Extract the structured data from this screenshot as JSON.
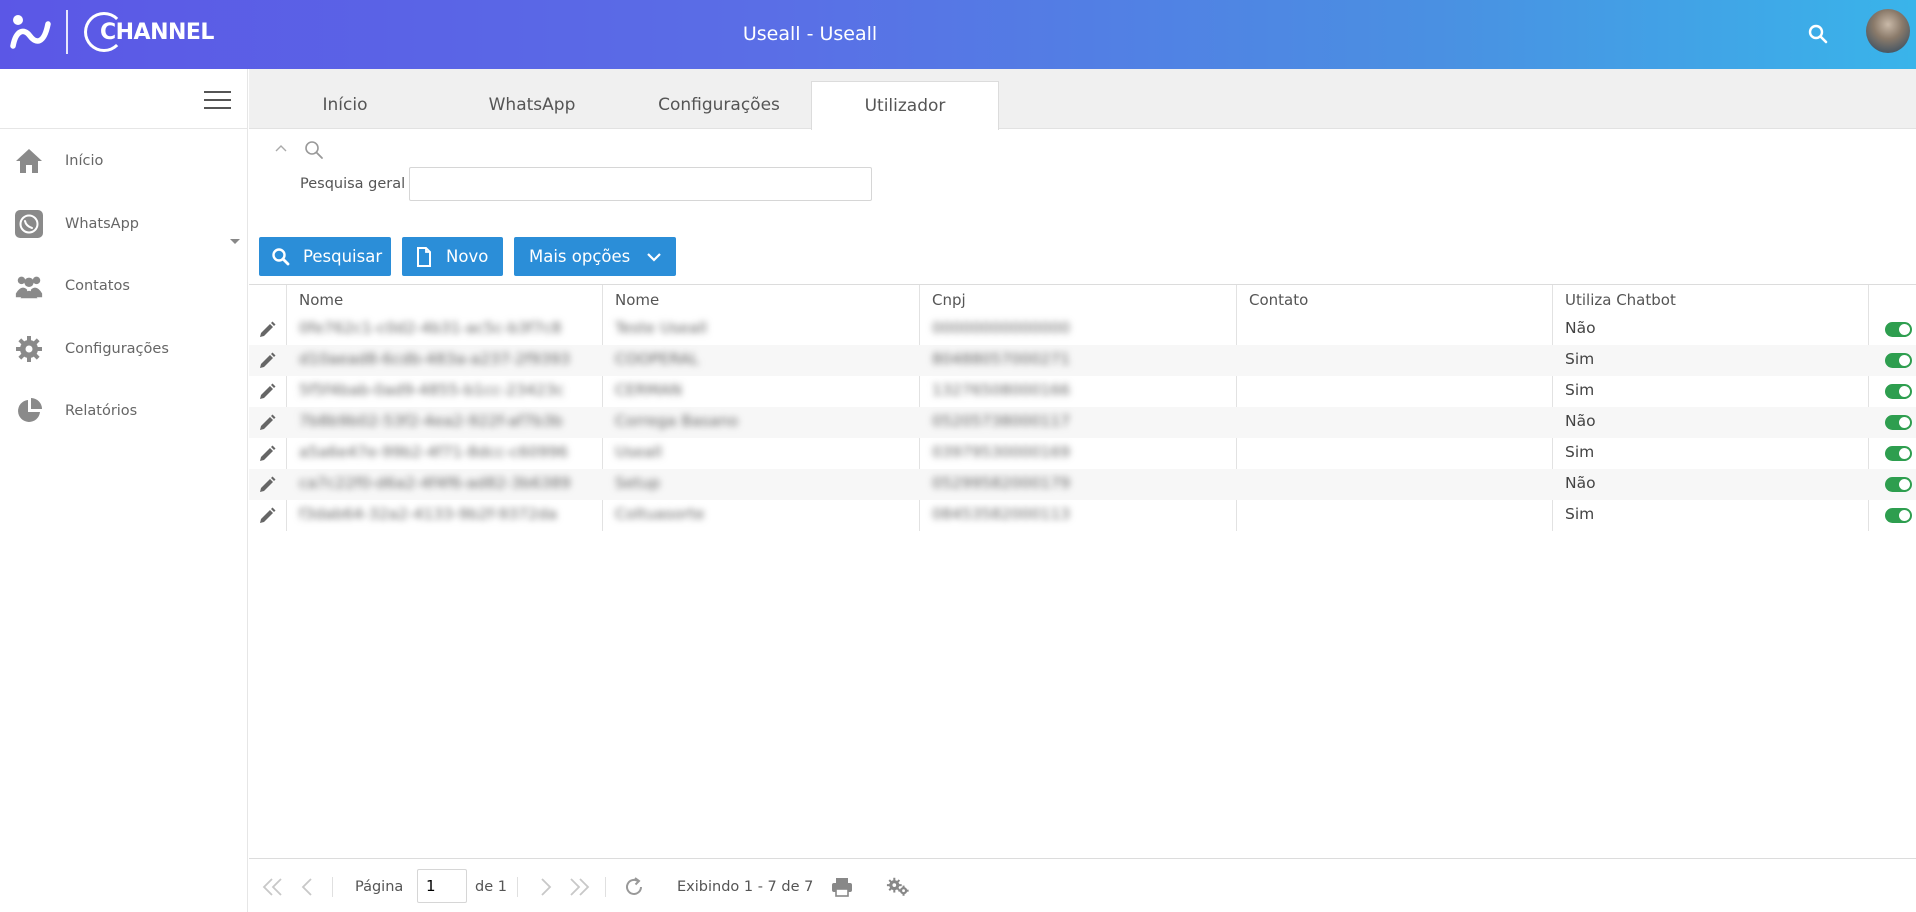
{
  "header": {
    "logo_text": "CHANNEL",
    "title": "Useall - Useall"
  },
  "sidebar": {
    "items": [
      {
        "label": "Início",
        "icon": "home-icon"
      },
      {
        "label": "WhatsApp",
        "icon": "whatsapp-icon"
      },
      {
        "label": "Contatos",
        "icon": "contacts-icon"
      },
      {
        "label": "Configurações",
        "icon": "gear-icon"
      },
      {
        "label": "Relatórios",
        "icon": "pie-chart-icon"
      }
    ]
  },
  "tabs": [
    {
      "label": "Início",
      "active": false
    },
    {
      "label": "WhatsApp",
      "active": false
    },
    {
      "label": "Configurações",
      "active": false
    },
    {
      "label": "Utilizador",
      "active": true
    }
  ],
  "search": {
    "label": "Pesquisa geral",
    "value": ""
  },
  "toolbar": {
    "search_label": "Pesquisar",
    "new_label": "Novo",
    "more_label": "Mais opções"
  },
  "table": {
    "columns": [
      "Nome",
      "Nome",
      "Cnpj",
      "Contato",
      "Utiliza Chatbot"
    ],
    "rows": [
      {
        "id": "0fe762c1-c0d2-4b31-ac5c-b3f7c8",
        "nome": "Teste Useall",
        "cnpj": "00000000000000",
        "contato": "",
        "chatbot": "Não",
        "active": true
      },
      {
        "id": "d10aead8-6cdb-483a-a237-2f9393",
        "nome": "COOPERAL",
        "cnpj": "80488057000271",
        "contato": "",
        "chatbot": "Sim",
        "active": true
      },
      {
        "id": "5f5f4bab-0ad9-4855-b1cc-23423c",
        "nome": "CERMAN",
        "cnpj": "13276508000166",
        "contato": "",
        "chatbot": "Sim",
        "active": true
      },
      {
        "id": "7b8b9b02-53f2-4ea2-922f-af7b3b",
        "nome": "Correga Basano",
        "cnpj": "05205738000117",
        "contato": "",
        "chatbot": "Não",
        "active": true
      },
      {
        "id": "a5a6e47e-99b2-4f71-8dcc-c60996",
        "nome": "Useall",
        "cnpj": "03979530000169",
        "contato": "",
        "chatbot": "Sim",
        "active": true
      },
      {
        "id": "ca7c22f0-d6a2-4f4f6-ad82-3b6389",
        "nome": "Setup",
        "cnpj": "05299582000179",
        "contato": "",
        "chatbot": "Não",
        "active": true
      },
      {
        "id": "f3dab64-32a2-4133-9b2f-9372da",
        "nome": "Coltuasorte",
        "cnpj": "08453582000113",
        "contato": "",
        "chatbot": "Sim",
        "active": true
      }
    ]
  },
  "pager": {
    "page_label": "Página",
    "page_value": "1",
    "of_label": "de 1",
    "display_text": "Exibindo 1 - 7 de 7"
  },
  "colors": {
    "accent": "#2b8ed8",
    "toggle_on": "#2e9e4f",
    "header_start": "#5b57e6",
    "header_end": "#39b4ea"
  }
}
